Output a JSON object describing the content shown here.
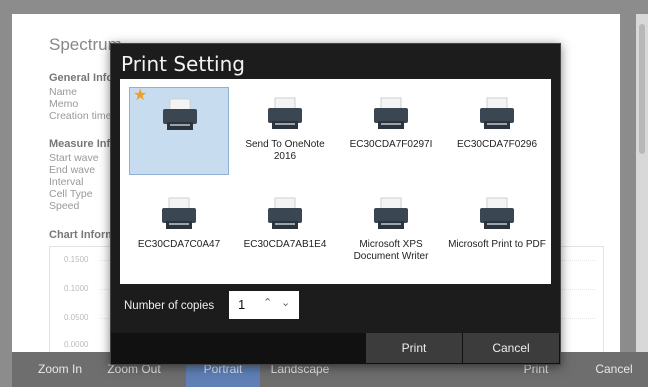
{
  "background": {
    "title": "Spectrum",
    "general_heading": "General Info",
    "general_labels": [
      "Name",
      "Memo",
      "Creation time"
    ],
    "measure_heading": "Measure Info",
    "measure_labels": [
      "Start wave",
      "End wave",
      "Interval",
      "Cell Type",
      "Speed"
    ],
    "chart_heading": "Chart Information",
    "chart_ticks": [
      "0.1500",
      "0.1000",
      "0.0500",
      "0.0000"
    ]
  },
  "toolbar": {
    "zoom_in": "Zoom In",
    "zoom_out": "Zoom Out",
    "portrait": "Portrait",
    "landscape": "Landscape",
    "print": "Print",
    "cancel": "Cancel"
  },
  "dialog": {
    "title": "Print Setting",
    "printers": [
      {
        "name": "",
        "selected": true,
        "default": true
      },
      {
        "name": "Send To OneNote 2016",
        "selected": false
      },
      {
        "name": "EC30CDA7F0297I",
        "selected": false
      },
      {
        "name": "EC30CDA7F0296",
        "selected": false
      },
      {
        "name": "EC30CDA7C0A47",
        "selected": false
      },
      {
        "name": "EC30CDA7AB1E4",
        "selected": false
      },
      {
        "name": "Microsoft XPS Document Writer",
        "selected": false
      },
      {
        "name": "Microsoft Print to PDF",
        "selected": false
      }
    ],
    "copies_label": "Number of copies",
    "copies_value": "1",
    "print_button": "Print",
    "cancel_button": "Cancel"
  },
  "icons": {
    "printer": "printer-icon",
    "default_star": "star-icon",
    "up": "chevron-up-icon",
    "down": "chevron-down-icon"
  },
  "colors": {
    "dialog_bg": "#1c1c1c",
    "selected_tile": "#c8dcef",
    "default_star": "#f0a020",
    "active_toolbar": "#5f7fb6"
  }
}
